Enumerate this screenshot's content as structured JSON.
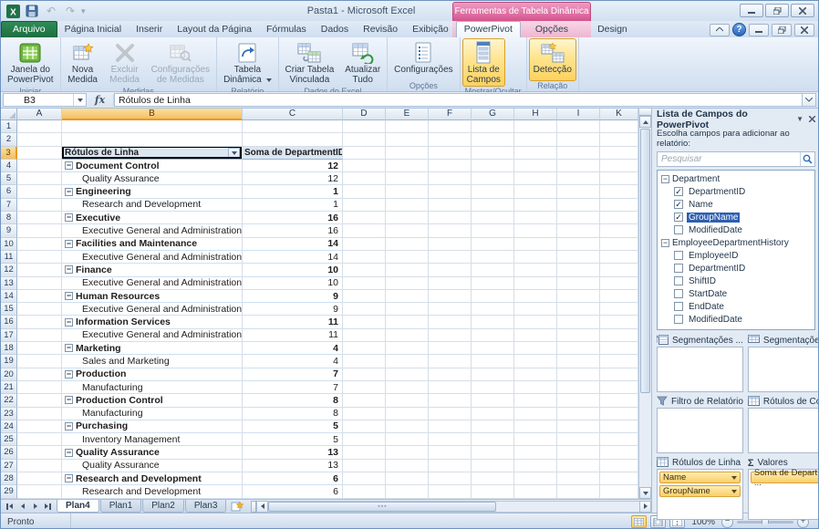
{
  "window": {
    "title": "Pasta1 - Microsoft Excel",
    "status": "Pronto",
    "zoom_level": "100%"
  },
  "contextual_tools": {
    "title": "Ferramentas de Tabela Dinâmica",
    "tabs": [
      "Opções",
      "Design"
    ]
  },
  "tabs": [
    {
      "label": "Arquivo",
      "type": "file"
    },
    {
      "label": "Página Inicial",
      "type": "normal"
    },
    {
      "label": "Inserir",
      "type": "normal"
    },
    {
      "label": "Layout da Página",
      "type": "normal"
    },
    {
      "label": "Fórmulas",
      "type": "normal"
    },
    {
      "label": "Dados",
      "type": "normal"
    },
    {
      "label": "Revisão",
      "type": "normal"
    },
    {
      "label": "Exibição",
      "type": "normal"
    },
    {
      "label": "PowerPivot",
      "type": "active"
    }
  ],
  "ribbon": {
    "groups": [
      {
        "name": "Iniciar",
        "buttons": [
          {
            "lines": [
              "Janela do",
              "PowerPivot"
            ],
            "icon": "powerpivot-window-icon"
          }
        ]
      },
      {
        "name": "Medidas",
        "buttons": [
          {
            "lines": [
              "Nova",
              "Medida"
            ],
            "icon": "new-measure-icon"
          },
          {
            "lines": [
              "Excluir",
              "Medida"
            ],
            "icon": "delete-measure-icon",
            "disabled": true
          },
          {
            "lines": [
              "Configurações",
              "de Medidas"
            ],
            "icon": "measure-settings-icon",
            "disabled": true
          }
        ]
      },
      {
        "name": "Relatório",
        "buttons": [
          {
            "lines": [
              "Tabela",
              "Dinâmica"
            ],
            "icon": "pivottable-icon",
            "dropdown": true
          }
        ]
      },
      {
        "name": "Dados do Excel",
        "buttons": [
          {
            "lines": [
              "Criar Tabela",
              "Vinculada"
            ],
            "icon": "linked-table-icon"
          },
          {
            "lines": [
              "Atualizar",
              "Tudo"
            ],
            "icon": "refresh-all-icon"
          }
        ]
      },
      {
        "name": "Opções",
        "buttons": [
          {
            "lines": [
              "Configurações"
            ],
            "icon": "settings-icon"
          }
        ]
      },
      {
        "name": "Mostrar/Ocultar",
        "buttons": [
          {
            "lines": [
              "Lista de",
              "Campos"
            ],
            "icon": "field-list-icon",
            "toggled": true
          }
        ]
      },
      {
        "name": "Relação",
        "buttons": [
          {
            "lines": [
              "Detecção"
            ],
            "icon": "detection-icon",
            "toggled": true
          }
        ]
      }
    ]
  },
  "formula_bar": {
    "name_box": "B3",
    "formula": "Rótulos de Linha"
  },
  "grid": {
    "column_headers": [
      "A",
      "B",
      "C",
      "D",
      "E",
      "F",
      "G",
      "H",
      "I",
      "K"
    ],
    "selected_column": "B",
    "selected_row": 3,
    "visible_rows": 29
  },
  "pivot": {
    "header": {
      "row_label": "Rótulos de Linha",
      "value_label": "Soma de DepartmentID"
    },
    "rows": [
      {
        "t": "g",
        "label": "Document Control",
        "value": "12"
      },
      {
        "t": "i",
        "label": "Quality Assurance",
        "value": "12"
      },
      {
        "t": "g",
        "label": "Engineering",
        "value": "1"
      },
      {
        "t": "i",
        "label": "Research and Development",
        "value": "1"
      },
      {
        "t": "g",
        "label": "Executive",
        "value": "16"
      },
      {
        "t": "i",
        "label": "Executive General and Administration",
        "value": "16"
      },
      {
        "t": "g",
        "label": "Facilities and Maintenance",
        "value": "14"
      },
      {
        "t": "i",
        "label": "Executive General and Administration",
        "value": "14"
      },
      {
        "t": "g",
        "label": "Finance",
        "value": "10"
      },
      {
        "t": "i",
        "label": "Executive General and Administration",
        "value": "10"
      },
      {
        "t": "g",
        "label": "Human Resources",
        "value": "9"
      },
      {
        "t": "i",
        "label": "Executive General and Administration",
        "value": "9"
      },
      {
        "t": "g",
        "label": "Information Services",
        "value": "11"
      },
      {
        "t": "i",
        "label": "Executive General and Administration",
        "value": "11"
      },
      {
        "t": "g",
        "label": "Marketing",
        "value": "4"
      },
      {
        "t": "i",
        "label": "Sales and Marketing",
        "value": "4"
      },
      {
        "t": "g",
        "label": "Production",
        "value": "7"
      },
      {
        "t": "i",
        "label": "Manufacturing",
        "value": "7"
      },
      {
        "t": "g",
        "label": "Production Control",
        "value": "8"
      },
      {
        "t": "i",
        "label": "Manufacturing",
        "value": "8"
      },
      {
        "t": "g",
        "label": "Purchasing",
        "value": "5"
      },
      {
        "t": "i",
        "label": "Inventory Management",
        "value": "5"
      },
      {
        "t": "g",
        "label": "Quality Assurance",
        "value": "13"
      },
      {
        "t": "i",
        "label": "Quality Assurance",
        "value": "13"
      },
      {
        "t": "g",
        "label": "Research and Development",
        "value": "6"
      },
      {
        "t": "i",
        "label": "Research and Development",
        "value": "6"
      }
    ]
  },
  "sheet_tabs": {
    "tabs": [
      "Plan4",
      "Plan1",
      "Plan2",
      "Plan3"
    ],
    "active": "Plan4"
  },
  "pane": {
    "title": "Lista de Campos do PowerPivot",
    "subtitle": "Escolha campos para adicionar ao relatório:",
    "search_placeholder": "Pesquisar",
    "tables": [
      {
        "name": "Department",
        "fields": [
          {
            "name": "DepartmentID",
            "checked": true
          },
          {
            "name": "Name",
            "checked": true
          },
          {
            "name": "GroupName",
            "checked": true,
            "selected": true
          },
          {
            "name": "ModifiedDate",
            "checked": false
          }
        ]
      },
      {
        "name": "EmployeeDepartmentHistory",
        "fields": [
          {
            "name": "EmployeeID",
            "checked": false
          },
          {
            "name": "DepartmentID",
            "checked": false
          },
          {
            "name": "ShiftID",
            "checked": false
          },
          {
            "name": "StartDate",
            "checked": false
          },
          {
            "name": "EndDate",
            "checked": false
          },
          {
            "name": "ModifiedDate",
            "checked": false
          }
        ]
      }
    ],
    "zones": [
      {
        "id": "slicers-vertical",
        "label": "Segmentações ...",
        "icon": "slicer-vertical-icon",
        "items": []
      },
      {
        "id": "slicers-horizontal",
        "label": "Segmentações ...",
        "icon": "slicer-horizontal-icon",
        "items": []
      },
      {
        "id": "report-filter",
        "label": "Filtro de Relatório",
        "icon": "filter-icon",
        "items": []
      },
      {
        "id": "column-labels",
        "label": "Rótulos  de Colu...",
        "icon": "table-icon",
        "items": []
      },
      {
        "id": "row-labels",
        "label": "Rótulos de Linha",
        "icon": "table-icon",
        "items": [
          "Name",
          "GroupName"
        ],
        "tall": true
      },
      {
        "id": "values",
        "label": "Valores",
        "icon": "sigma-icon",
        "items": [
          "Soma  de Depart ..."
        ],
        "tall": true
      }
    ]
  },
  "status_bar": {
    "left": "Pronto",
    "zoom": "100%"
  }
}
